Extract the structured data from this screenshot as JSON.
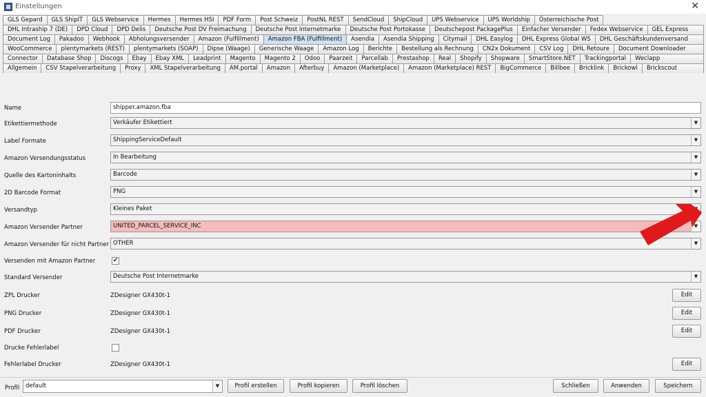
{
  "window": {
    "title": "Einstellungen",
    "close_glyph": "✕"
  },
  "tabs": {
    "rows": [
      [
        "GLS Gepard",
        "GLS ShipIT",
        "GLS Webservice",
        "Hermes",
        "Hermes HSI",
        "PDF Form",
        "Post Schweiz",
        "PostNL REST",
        "SendCloud",
        "ShipCloud",
        "UPS Webservice",
        "UPS Worldship",
        "Österreichische Post"
      ],
      [
        "DHL Intraship 7 (DE)",
        "DPD Cloud",
        "DPD Delis",
        "Deutsche Post DV Freimachung",
        "Deutsche Post Internetmarke",
        "Deutsche Post Portokasse",
        "Deutschepost PackagePlus",
        "Einfacher Versender",
        "Fedex Webservice",
        "GEL Express"
      ],
      [
        "Document Log",
        "Pakadoo",
        "Webhook",
        "Abholungsversender",
        "Amazon (Fulfillment)",
        "Amazon FBA (Fulfillment)",
        "Asendia",
        "Asendia Shipping",
        "Citymail",
        "DHL Easylog",
        "DHL Express Global WS",
        "DHL Geschäftskundenversand"
      ],
      [
        "WooCommerce",
        "plentymarkets (REST)",
        "plentymarkets (SOAP)",
        "Dipse (Waage)",
        "Generische Waage",
        "Amazon Log",
        "Berichte",
        "Bestellung als Rechnung",
        "CN2x Dokument",
        "CSV Log",
        "DHL Retoure",
        "Document Downloader"
      ],
      [
        "Connector",
        "Database Shop",
        "Discogs",
        "Ebay",
        "Ebay XML",
        "Leadprint",
        "Magento",
        "Magento 2",
        "Odoo",
        "Paarzeit",
        "Parcellab",
        "Prestashop",
        "Real",
        "Shopify",
        "Shopware",
        "SmartStore.NET",
        "Trackingportal",
        "Weclapp"
      ],
      [
        "Allgemein",
        "CSV Stapelverarbeitung",
        "Proxy",
        "XML Stapelverarbeitung",
        "AM.portal",
        "Amazon",
        "Afterbuy",
        "Amazon (Marketplace)",
        "Amazon (Marketplace) REST",
        "BigCommerce",
        "Billbee",
        "Bricklink",
        "Brickowl",
        "Brickscout"
      ]
    ],
    "selected": "Amazon FBA (Fulfillment)"
  },
  "form": {
    "name": {
      "label": "Name",
      "value": "shipper.amazon.fba"
    },
    "etikettiermethode": {
      "label": "Etikettiermethode",
      "value": "Verkäufer Etikettiert"
    },
    "label_formate": {
      "label": "Label Formate",
      "value": "ShippingServiceDefault"
    },
    "versendungsstatus": {
      "label": "Amazon Versendungsstatus",
      "value": "In Bearbeitung"
    },
    "kartoninhalt": {
      "label": "Quelle des Kartoninhalts",
      "value": "Barcode"
    },
    "barcode_format": {
      "label": "2D Barcode Format",
      "value": "PNG"
    },
    "versandtyp": {
      "label": "Versandtyp",
      "value": "Kleines Paket"
    },
    "versender_partner": {
      "label": "Amazon Versender Partner",
      "value": "UNITED_PARCEL_SERVICE_INC"
    },
    "versender_nicht_partner": {
      "label": "Amazon Versender für nicht Partner",
      "value": "OTHER"
    },
    "versenden_mit_partner": {
      "label": "Versenden mit Amazon Partner",
      "checked": true,
      "glyph": "✔"
    },
    "standard_versender": {
      "label": "Standard Versender",
      "value": "Deutsche Post Internetmarke"
    },
    "zpl_drucker": {
      "label": "ZPL Drucker",
      "value": "ZDesigner GX430t-1"
    },
    "png_drucker": {
      "label": "PNG Drucker",
      "value": "ZDesigner GX430t-1"
    },
    "pdf_drucker": {
      "label": "PDF Drucker",
      "value": "ZDesigner GX430t-1"
    },
    "drucke_fehlerlabel": {
      "label": "Drucke Fehlerlabel",
      "checked": false
    },
    "fehlerlabel_drucker": {
      "label": "Fehlerlabel Drucker",
      "value": "ZDesigner GX430t-1"
    },
    "edit_label": "Edit",
    "combo_glyph": "▼"
  },
  "bottom": {
    "profil_label": "Profil",
    "profil_value": "default",
    "profil_erstellen": "Profil erstellen",
    "profil_kopieren": "Profil kopieren",
    "profil_loeschen": "Profil löschen",
    "schliessen": "Schließen",
    "anwenden": "Anwenden",
    "speichern": "Speichern"
  },
  "colors": {
    "highlight_field": "#f4bcbc",
    "arrow": "#e01a1a",
    "selected_tab": "#cfe0f2"
  }
}
